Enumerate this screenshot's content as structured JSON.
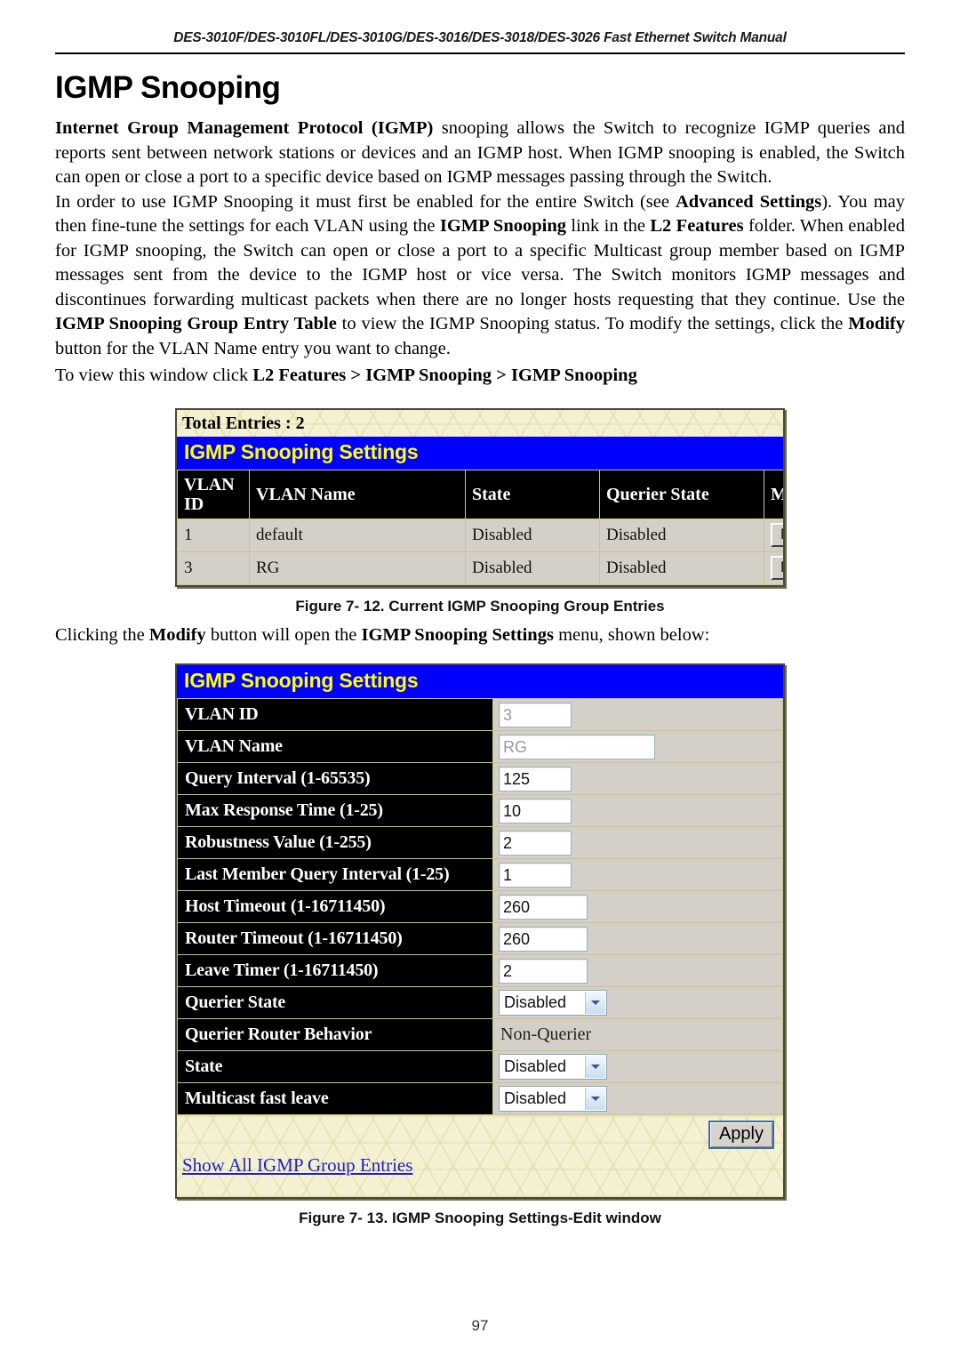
{
  "header": {
    "running_title": "DES-3010F/DES-3010FL/DES-3010G/DES-3016/DES-3018/DES-3026 Fast Ethernet Switch Manual"
  },
  "page_title": "IGMP Snooping",
  "paragraphs": {
    "p1_b1": "Internet Group Management Protocol (IGMP)",
    "p1_rest": " snooping allows the Switch to recognize IGMP queries and reports sent between network stations or devices and an IGMP host. When IGMP snooping is enabled, the Switch can open or close a port to a specific device based on IGMP messages passing through the Switch.",
    "p2_a": "In order to use IGMP Snooping it must first be enabled for the entire Switch (see ",
    "p2_b1": "Advanced Settings",
    "p2_b": "). You may then fine-tune the settings for each VLAN using the ",
    "p2_b2": "IGMP Snooping",
    "p2_c": " link in the ",
    "p2_b3": "L2 Features",
    "p2_d": " folder. When enabled for IGMP snooping, the Switch can open or close a port to a specific Multicast group member based on IGMP messages sent from the device to the IGMP host or vice versa. The Switch monitors IGMP messages and discontinues forwarding multicast packets when there are no longer hosts requesting that they continue. Use the ",
    "p2_b4": "IGMP Snooping Group Entry Table",
    "p2_e": " to view the IGMP Snooping status. To modify the settings, click the ",
    "p2_b5": "Modify",
    "p2_f": " button for the VLAN Name entry you want to change.",
    "nav_a": "To view this window click ",
    "nav_b": "L2 Features > IGMP Snooping > IGMP Snooping",
    "clicking_a": "Clicking the ",
    "clicking_b1": "Modify",
    "clicking_b": " button will open the ",
    "clicking_b2": "IGMP Snooping Settings",
    "clicking_c": " menu, shown below:"
  },
  "entries_window": {
    "total_entries": "Total Entries : 2",
    "title_bar": "IGMP Snooping Settings",
    "columns": [
      "VLAN ID",
      "VLAN Name",
      "State",
      "Querier State",
      "Modify"
    ],
    "rows": [
      {
        "vlan_id": "1",
        "vlan_name": "default",
        "state": "Disabled",
        "querier_state": "Disabled",
        "modify_label": "Modify"
      },
      {
        "vlan_id": "3",
        "vlan_name": "RG",
        "state": "Disabled",
        "querier_state": "Disabled",
        "modify_label": "Modify"
      }
    ]
  },
  "figure_1_caption": "Figure 7- 12. Current IGMP Snooping Group Entries",
  "edit_window": {
    "title_bar": "IGMP Snooping Settings",
    "fields": [
      {
        "label": "VLAN ID",
        "value": "3",
        "type": "textbox-disabled",
        "size": "sm"
      },
      {
        "label": "VLAN Name",
        "value": "RG",
        "type": "textbox-disabled",
        "size": "lg"
      },
      {
        "label": "Query Interval (1-65535)",
        "value": "125",
        "type": "textbox",
        "size": "sm"
      },
      {
        "label": "Max Response Time (1-25)",
        "value": "10",
        "type": "textbox",
        "size": "sm"
      },
      {
        "label": "Robustness Value (1-255)",
        "value": "2",
        "type": "textbox",
        "size": "sm"
      },
      {
        "label": "Last Member Query Interval (1-25)",
        "value": "1",
        "type": "textbox",
        "size": "sm"
      },
      {
        "label": "Host Timeout (1-16711450)",
        "value": "260",
        "type": "textbox",
        "size": "md"
      },
      {
        "label": "Router Timeout (1-16711450)",
        "value": "260",
        "type": "textbox",
        "size": "md"
      },
      {
        "label": "Leave Timer (1-16711450)",
        "value": "2",
        "type": "textbox",
        "size": "md"
      },
      {
        "label": "Querier State",
        "value": "Disabled",
        "type": "select"
      },
      {
        "label": "Querier Router Behavior",
        "value": "Non-Querier",
        "type": "static"
      },
      {
        "label": "State",
        "value": "Disabled",
        "type": "select"
      },
      {
        "label": "Multicast fast leave",
        "value": "Disabled",
        "type": "select"
      }
    ],
    "apply_label": "Apply",
    "show_all_link": "Show All IGMP Group Entries"
  },
  "figure_2_caption": "Figure 7- 13. IGMP Snooping Settings-Edit window",
  "page_number": "97",
  "colors": {
    "title_bar_bg": "#0000ff",
    "title_bar_text": "#ffff00",
    "header_cell_bg": "#000000",
    "data_cell_bg": "#d4d0c8",
    "window_bg": "#f4f0d2",
    "link": "#2020cc"
  }
}
